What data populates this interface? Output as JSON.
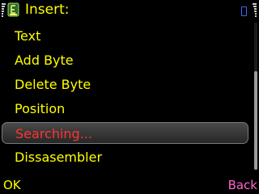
{
  "header": {
    "title": "Insert:",
    "app_icon": "app-icon",
    "signal_icon": "signal-bars-icon",
    "battery_icon": "battery-bars-icon",
    "tab_icon": "tab-indicator-icon"
  },
  "menu": {
    "items": [
      {
        "label": "Text",
        "selected": false
      },
      {
        "label": "Add Byte",
        "selected": false
      },
      {
        "label": "Delete Byte",
        "selected": false
      },
      {
        "label": "Position",
        "selected": false
      },
      {
        "label": "Searching...",
        "selected": true
      },
      {
        "label": "Dissasembler",
        "selected": false
      }
    ]
  },
  "softkeys": {
    "left": "OK",
    "right": "Back"
  },
  "colors": {
    "background": "#000000",
    "text": "#ffff00",
    "selected_text": "#ff3333",
    "right_softkey": "#ff66cc",
    "accent": "#2d6bff"
  }
}
